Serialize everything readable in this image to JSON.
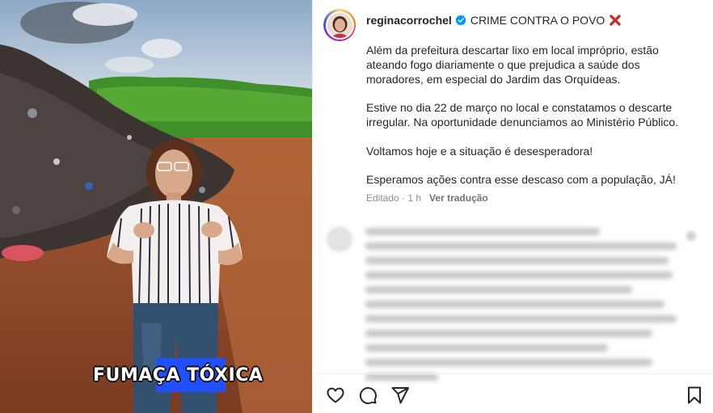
{
  "post": {
    "username": "reginacorrochel",
    "title": "CRIME CONTRA O POVO",
    "body": [
      "Além da prefeitura descartar lixo em local impróprio, estão ateando fogo diariamente o que prejudica a saúde dos moradores, em especial do Jardim das Orquídeas.",
      "Estive no dia 22 de março no local e constatamos o descarte irregular. Na oportunidade denunciamos ao Ministério Público.",
      "Voltamos hoje e a situação é desesperadora!",
      "Esperamos ações contra esse descaso com a população, JÁ!"
    ],
    "edited_label": "Editado · 1 h",
    "translate_label": "Ver tradução"
  },
  "media": {
    "caption_overlay": "FUMAÇA TÓXICA"
  },
  "icons": {
    "verified": "verified-badge-icon",
    "title_emoji": "cross-mark-icon",
    "like": "heart-icon",
    "comment": "comment-icon",
    "share": "share-icon",
    "save": "bookmark-icon"
  },
  "colors": {
    "verified_blue": "#0095f6",
    "cross_red": "#d0312d",
    "caption_highlight": "#1f4fff",
    "muted_text": "#8e8e8e"
  }
}
